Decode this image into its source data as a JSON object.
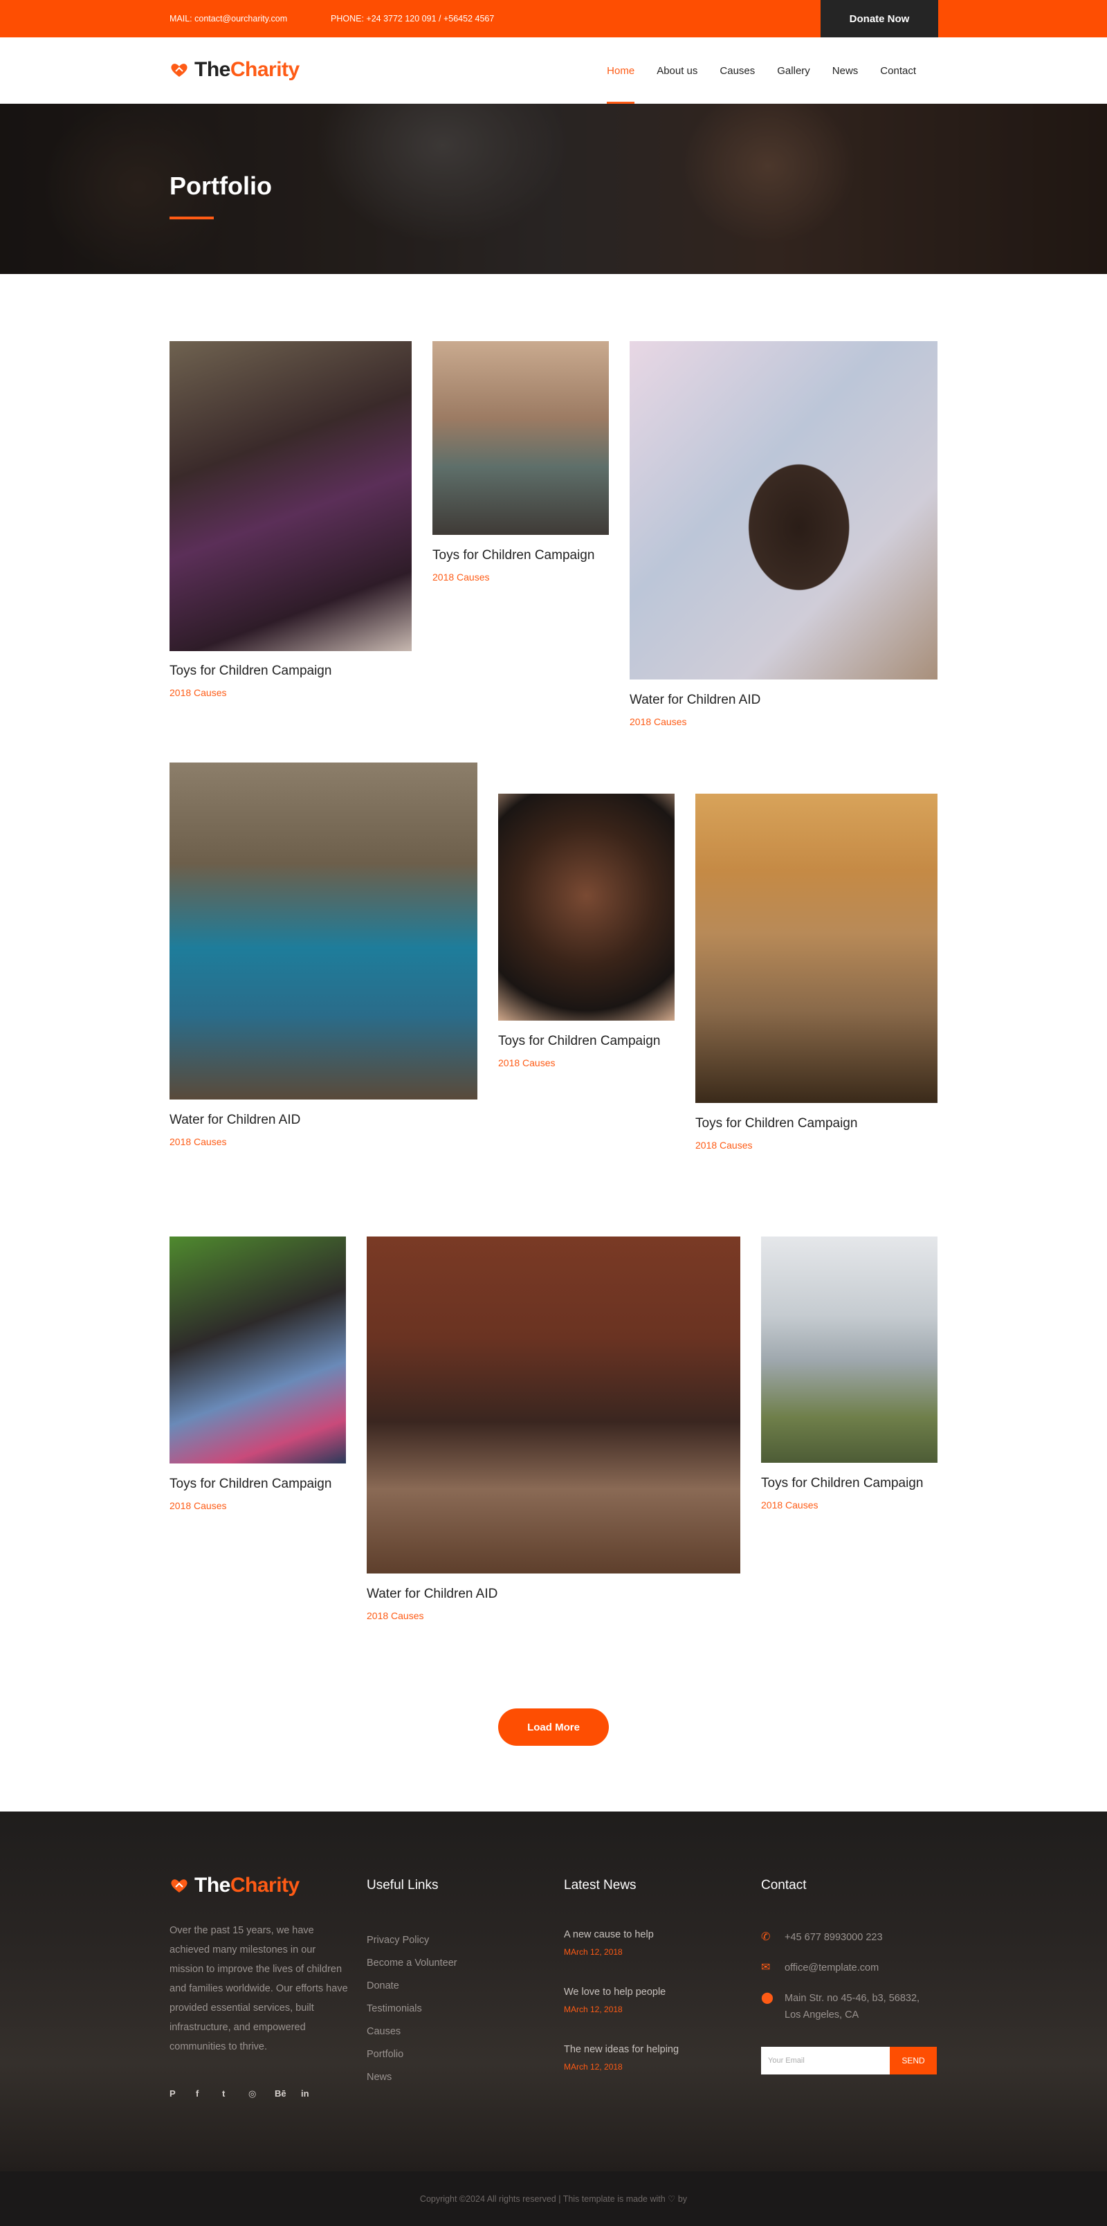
{
  "topbar": {
    "mail": "MAIL: contact@ourcharity.com",
    "phone": "PHONE: +24 3772 120 091 / +56452 4567",
    "donate_label": "Donate Now"
  },
  "brand": {
    "the": "The",
    "charity": "Charity"
  },
  "nav": {
    "items": [
      {
        "label": "Home",
        "active": true
      },
      {
        "label": "About us"
      },
      {
        "label": "Causes"
      },
      {
        "label": "Gallery"
      },
      {
        "label": "News"
      },
      {
        "label": "Contact"
      }
    ]
  },
  "banner": {
    "title": "Portfolio"
  },
  "portfolio": {
    "items": [
      {
        "title": "Toys for Children Campaign",
        "sub": "2018 Causes",
        "photo": "girls-group"
      },
      {
        "title": "Toys for Children Campaign",
        "sub": "2018 Causes",
        "photo": "child-playing-toy-car"
      },
      {
        "title": "Water for Children AID",
        "sub": "2018 Causes",
        "photo": "child-looking-up"
      },
      {
        "title": "Water for Children AID",
        "sub": "2018 Causes",
        "photo": "boys-with-camera"
      },
      {
        "title": "Toys for Children Campaign",
        "sub": "2018 Causes",
        "photo": "smiling-girl"
      },
      {
        "title": "Toys for Children Campaign",
        "sub": "2018 Causes",
        "photo": "kids-on-beach"
      },
      {
        "title": "Toys for Children Campaign",
        "sub": "2018 Causes",
        "photo": "three-children"
      },
      {
        "title": "Water for Children AID",
        "sub": "2018 Causes",
        "photo": "classroom"
      },
      {
        "title": "Toys for Children Campaign",
        "sub": "2018 Causes",
        "photo": "boy-with-guitar"
      }
    ],
    "load_more": "Load More"
  },
  "footer": {
    "about": "Over the past 15 years, we have achieved many milestones in our mission to improve the lives of children and families worldwide. Our efforts have provided essential services, built infrastructure, and empowered communities to thrive.",
    "socials": [
      "pinterest-icon",
      "facebook-icon",
      "twitter-icon",
      "dribbble-icon",
      "behance-icon",
      "linkedin-icon"
    ],
    "useful_links_title": "Useful Links",
    "links": [
      "Privacy Policy",
      "Become a Volunteer",
      "Donate",
      "Testimonials",
      "Causes",
      "Portfolio",
      "News"
    ],
    "news_title": "Latest News",
    "news": [
      {
        "title": "A new cause to help",
        "date": "MArch 12, 2018"
      },
      {
        "title": "We love to help people",
        "date": "MArch 12, 2018"
      },
      {
        "title": "The new ideas for helping",
        "date": "MArch 12, 2018"
      }
    ],
    "contact_title": "Contact",
    "phone": "+45 677 8993000 223",
    "email": "office@template.com",
    "address": "Main Str. no 45-46, b3, 56832, Los Angeles, CA",
    "newsletter_placeholder": "Your Email",
    "newsletter_button": "SEND"
  },
  "copyright": {
    "text": "Copyright ©2024 All rights reserved | This template is made with",
    "by": " by"
  }
}
